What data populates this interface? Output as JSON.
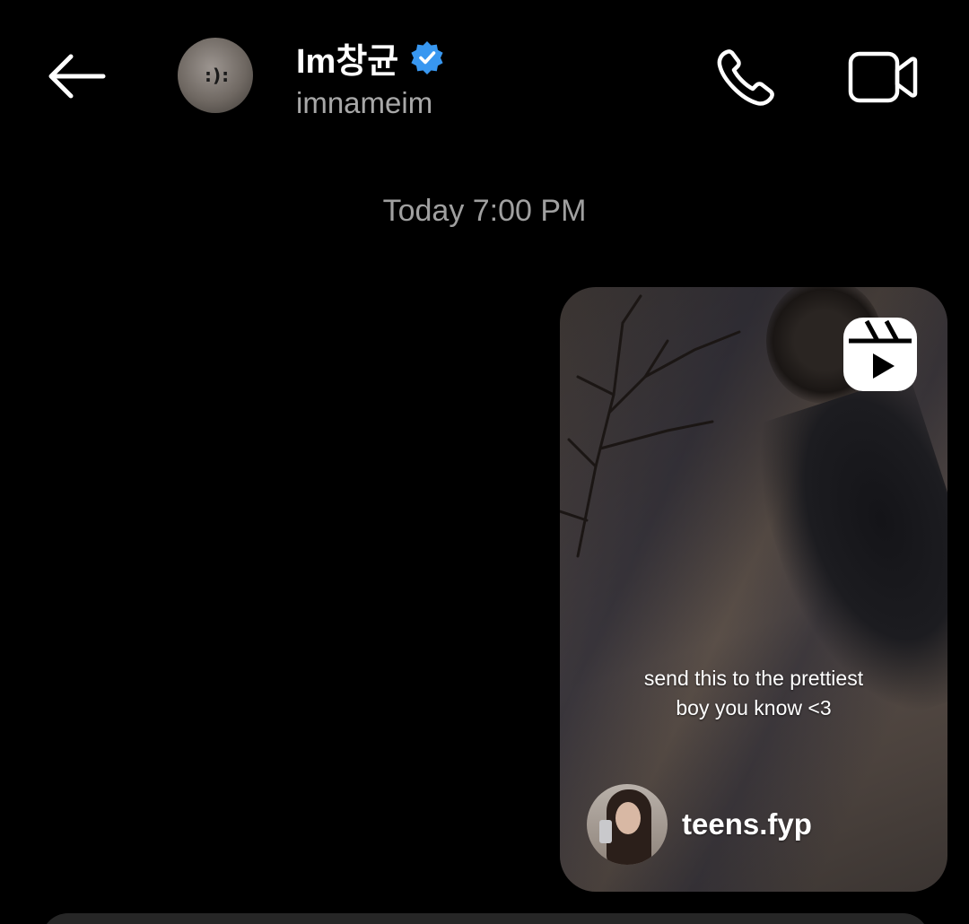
{
  "header": {
    "display_name": "Im창균",
    "username": "imnameim",
    "verified": true,
    "verified_color": "#3897f0",
    "back_icon": "arrow-left-icon",
    "call_icon": "phone-icon",
    "video_icon": "video-camera-icon"
  },
  "conversation": {
    "timestamp": "Today 7:00 PM",
    "shared_reel": {
      "badge_icon": "reels-icon",
      "caption_line1": "send this to the prettiest",
      "caption_line2": "boy you know <3",
      "author": "teens.fyp"
    }
  },
  "colors": {
    "background": "#000000",
    "secondary_text": "#a8a8a8",
    "composer": "#262626"
  }
}
